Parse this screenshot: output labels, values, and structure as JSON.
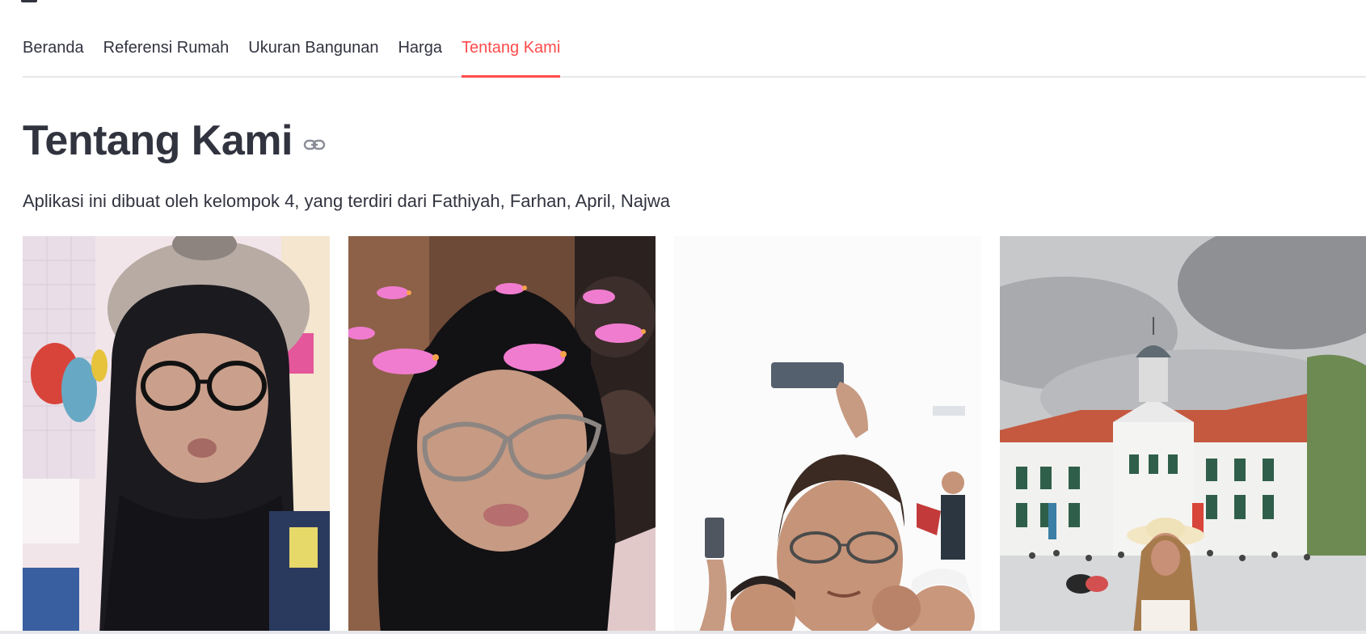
{
  "tabs": [
    {
      "label": "Beranda",
      "active": false
    },
    {
      "label": "Referensi Rumah",
      "active": false
    },
    {
      "label": "Ukuran Bangunan",
      "active": false
    },
    {
      "label": "Harga",
      "active": false
    },
    {
      "label": "Tentang Kami",
      "active": true
    }
  ],
  "main": {
    "title": "Tentang Kami",
    "anchor_icon": "link-icon",
    "description": "Aplikasi ini dibuat oleh kelompok 4, yang terdiri dari Fathiyah, Farhan, April, Najwa"
  },
  "colors": {
    "accent": "#ff4b4b",
    "text": "#31333f",
    "divider": "#e6e7ea"
  }
}
